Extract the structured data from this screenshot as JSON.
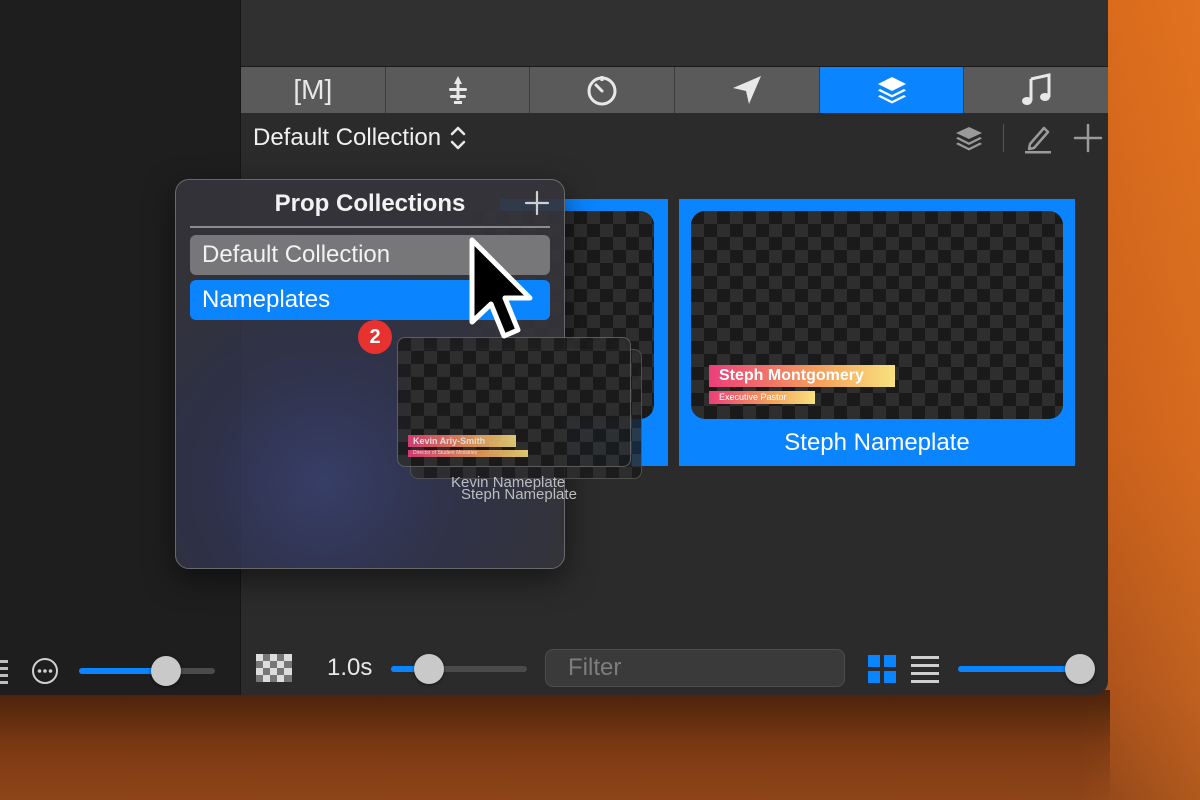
{
  "colors": {
    "accent": "#0a84ff",
    "badge": "#e8322f"
  },
  "tabs": [
    {
      "id": "macros",
      "label": "[M]",
      "icon": "macros-icon"
    },
    {
      "id": "stage",
      "icon": "stage-icon"
    },
    {
      "id": "timers",
      "icon": "timer-icon"
    },
    {
      "id": "messages",
      "icon": "send-icon"
    },
    {
      "id": "props",
      "icon": "layers-icon",
      "active": true
    },
    {
      "id": "audio",
      "icon": "music-note-icon"
    }
  ],
  "header": {
    "collection_title": "Default Collection"
  },
  "popover": {
    "title": "Prop Collections",
    "items": [
      {
        "label": "Default Collection"
      },
      {
        "label": "Nameplates"
      }
    ]
  },
  "drag": {
    "badge_count": "2",
    "front": {
      "label": "Kevin Nameplate",
      "name": "Kevin Ariy-Smith",
      "subtitle": "Director of Student Ministries"
    },
    "back": {
      "label": "Steph Nameplate"
    }
  },
  "cards": [
    {
      "label": "Steph Nameplate",
      "name": "Steph Montgomery",
      "subtitle": "Executive Pastor"
    }
  ],
  "bottom": {
    "duration": "1.0s",
    "duration_fraction": 0.28,
    "filter_placeholder": "Filter",
    "size_fraction": 0.9,
    "left_slider_fraction": 0.64
  }
}
